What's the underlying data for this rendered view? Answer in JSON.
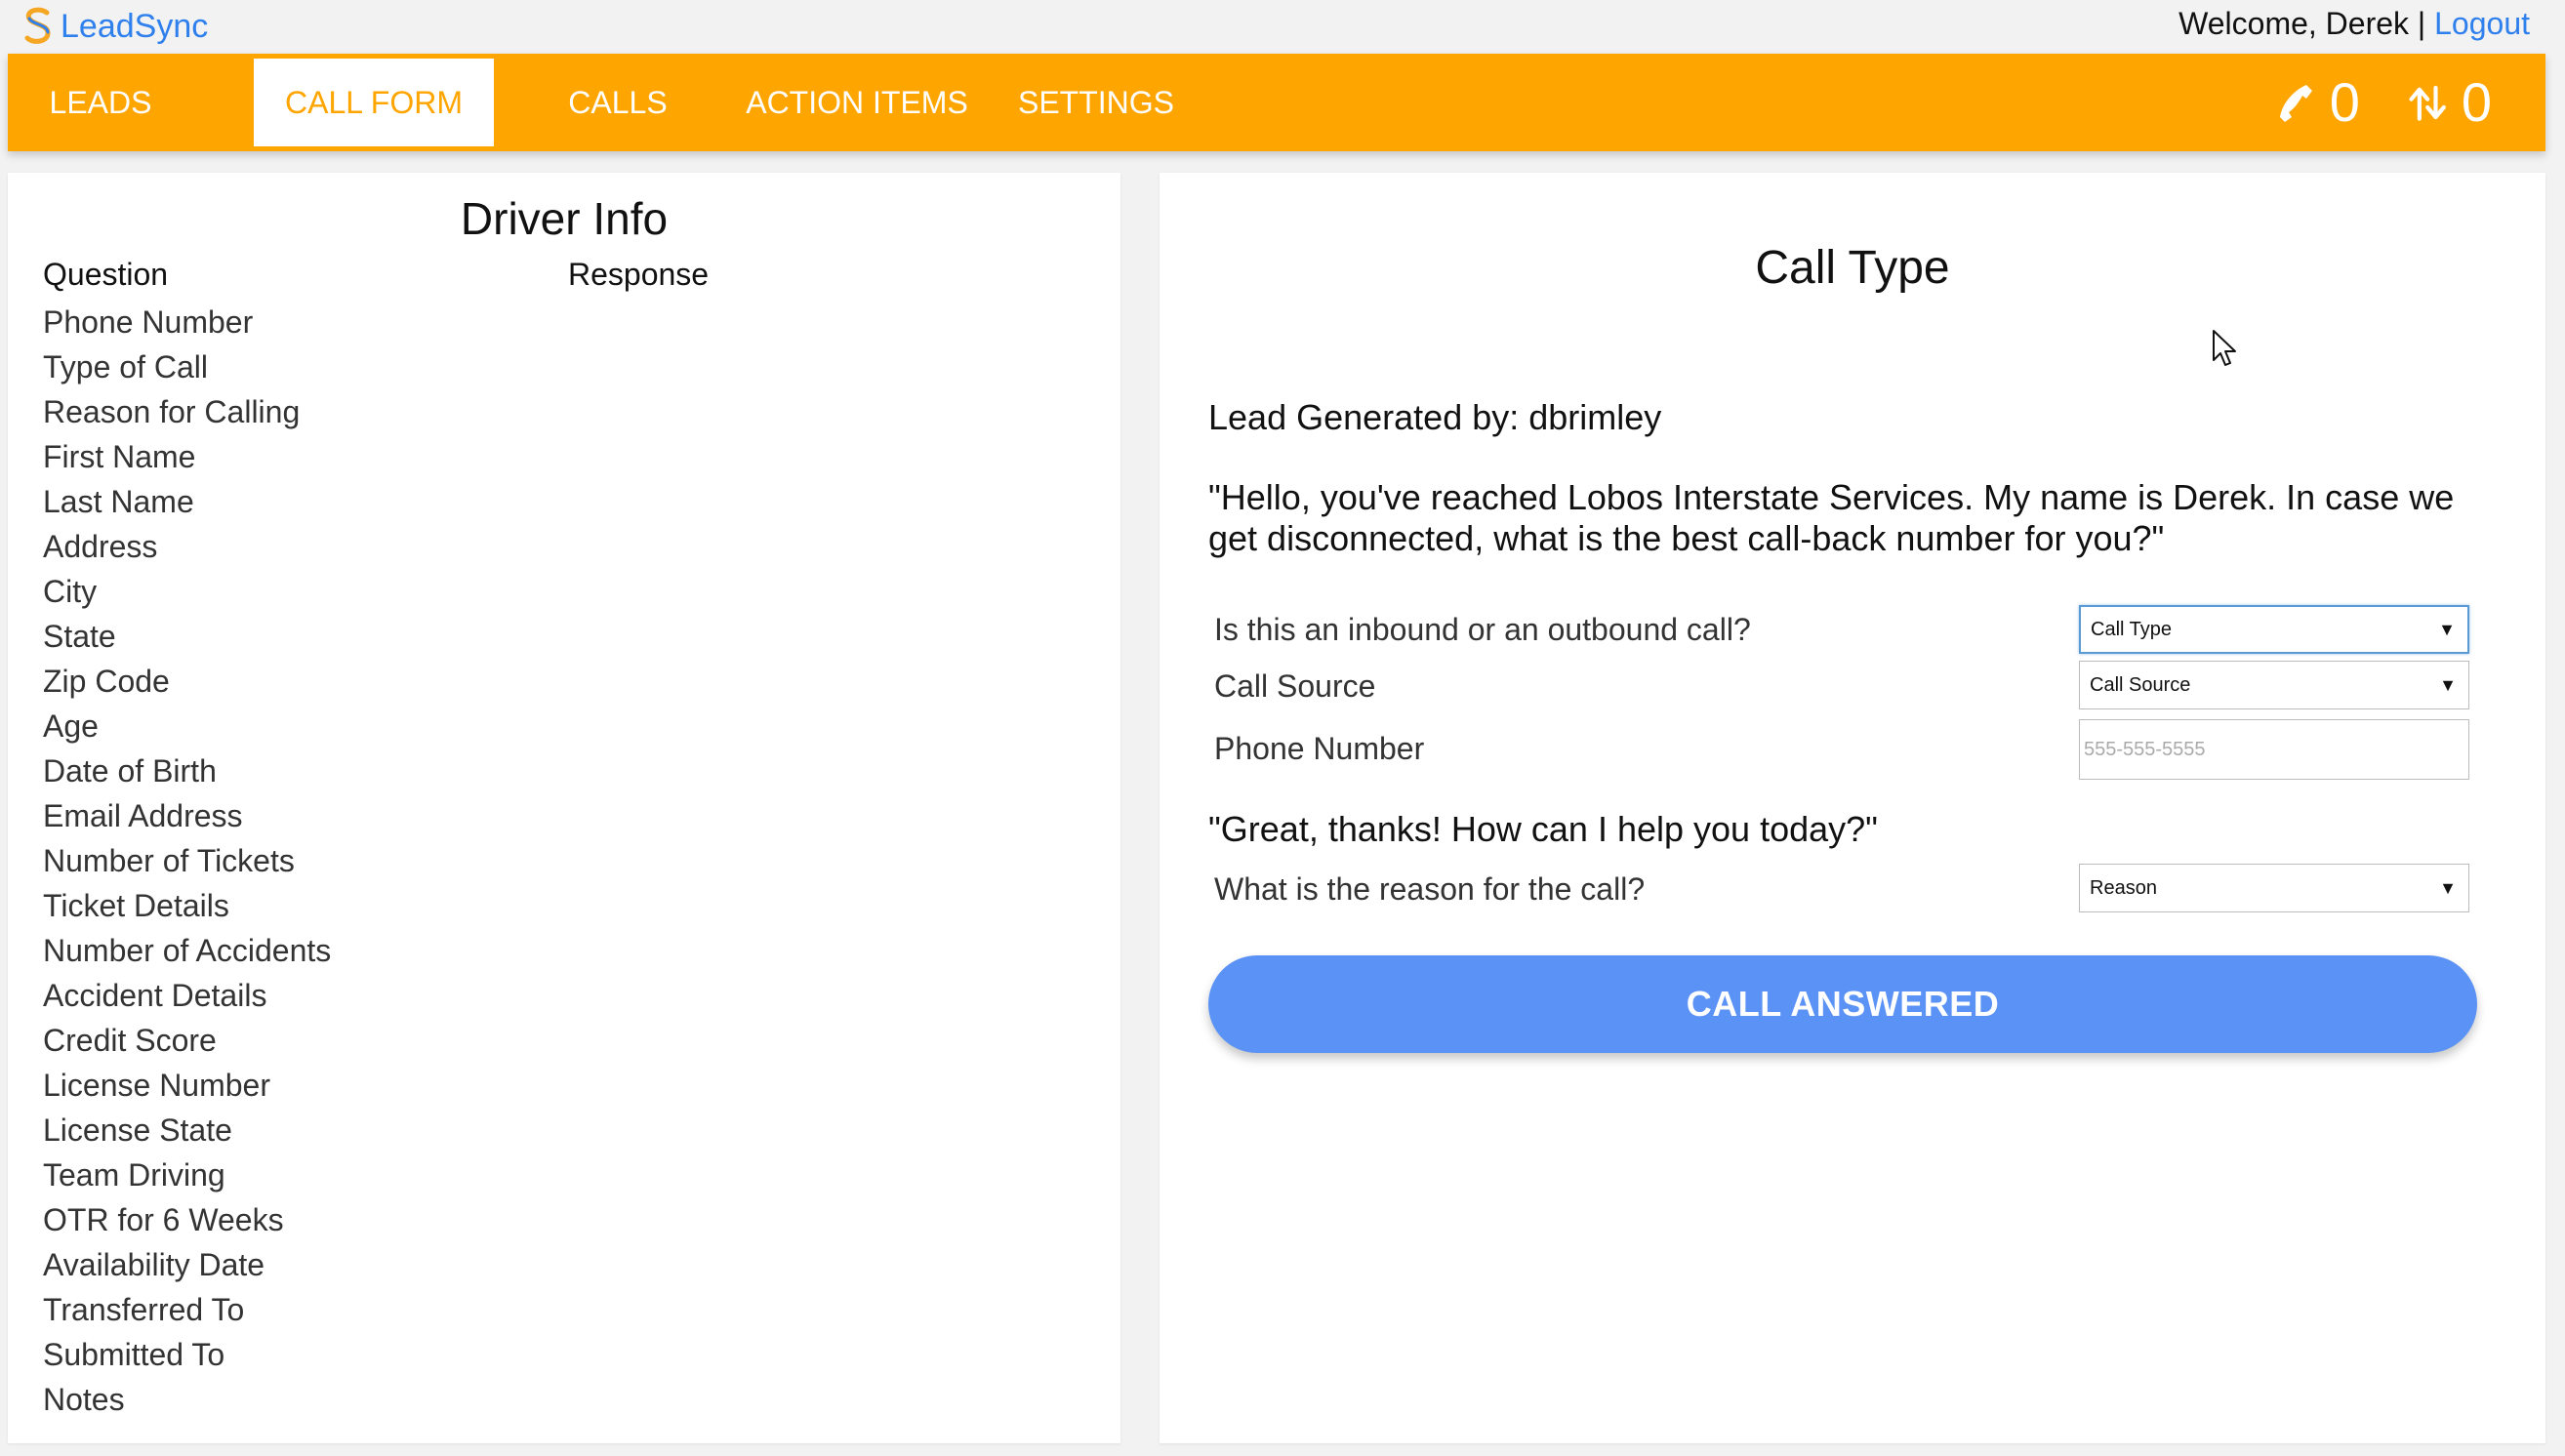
{
  "brand": {
    "name": "LeadSync"
  },
  "header": {
    "welcome": "Welcome, Derek | ",
    "logout": "Logout"
  },
  "nav": {
    "tabs": [
      {
        "label": "LEADS",
        "active": false
      },
      {
        "label": "CALL FORM",
        "active": true
      },
      {
        "label": "CALLS",
        "active": false
      },
      {
        "label": "ACTION ITEMS",
        "active": false
      },
      {
        "label": "SETTINGS",
        "active": false
      }
    ],
    "calls_count": "0",
    "transfers_count": "0"
  },
  "driver_info": {
    "title": "Driver Info",
    "question_header": "Question",
    "response_header": "Response",
    "questions": [
      "Phone Number",
      "Type of Call",
      "Reason for Calling",
      "First Name",
      "Last Name",
      "Address",
      "City",
      "State",
      "Zip Code",
      "Age",
      "Date of Birth",
      "Email Address",
      "Number of Tickets",
      "Ticket Details",
      "Number of Accidents",
      "Accident Details",
      "Credit Score",
      "License Number",
      "License State",
      "Team Driving",
      "OTR for 6 Weeks",
      "Availability Date",
      "Transferred To",
      "Submitted To",
      "Notes"
    ]
  },
  "call_type": {
    "title": "Call Type",
    "lead_generated": "Lead Generated by: dbrimley",
    "greeting": "\"Hello, you've reached Lobos Interstate Services. My name is Derek. In case we get disconnected, what is the best call-back number for you?\"",
    "inbound_question": "Is this an inbound or an outbound call?",
    "call_type_select": "Call Type",
    "call_source_label": "Call Source",
    "call_source_select": "Call Source",
    "phone_label": "Phone Number",
    "phone_placeholder": "555-555-5555",
    "help_prompt": "\"Great, thanks! How can I help you today?\"",
    "reason_question": "What is the reason for the call?",
    "reason_select": "Reason",
    "call_answered_button": "CALL ANSWERED"
  },
  "colors": {
    "nav_bg": "#ffa500",
    "accent_blue": "#2f80ed",
    "button_blue": "#5b92f5"
  }
}
